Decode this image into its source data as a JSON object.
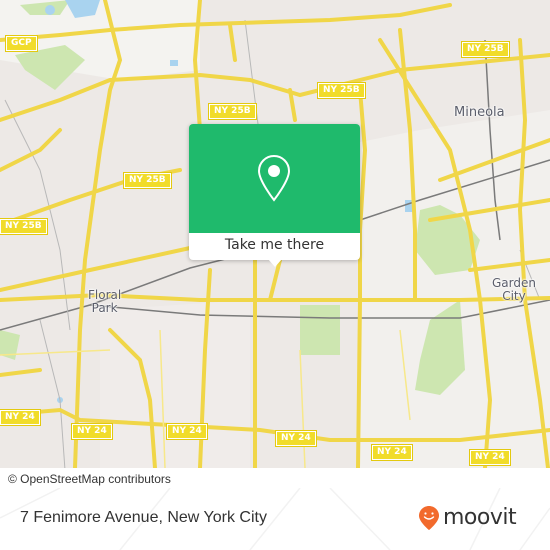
{
  "map": {
    "attribution": "© OpenStreetMap contributors",
    "colors": {
      "land": "#ede9e6",
      "road": "#f7e36a",
      "park": "#cde6b0",
      "water": "#a9d3ef",
      "rail": "#7a7a7a",
      "shield": "#f1dc2a",
      "accent": "#1fba6c",
      "moovit_orange": "#f26a2c"
    },
    "route_shields": [
      {
        "label": "GCP"
      },
      {
        "label": "NY 25B"
      },
      {
        "label": "NY 25B"
      },
      {
        "label": "NY 25B"
      },
      {
        "label": "NY 25B"
      },
      {
        "label": "NY 25B"
      },
      {
        "label": "NY 24"
      },
      {
        "label": "NY 24"
      },
      {
        "label": "NY 24"
      },
      {
        "label": "NY 24"
      },
      {
        "label": "NY 24"
      },
      {
        "label": "NY 24"
      }
    ],
    "places": [
      {
        "label": "Mineola"
      },
      {
        "label": "Garden\nCity"
      },
      {
        "label": "Floral\nPark"
      }
    ]
  },
  "popup": {
    "icon": "location-pin-icon",
    "button_label": "Take me there"
  },
  "footer": {
    "address": "7 Fenimore Avenue, New York City",
    "brand": "moovit",
    "brand_icon": "moovit-smile-pin-icon"
  }
}
